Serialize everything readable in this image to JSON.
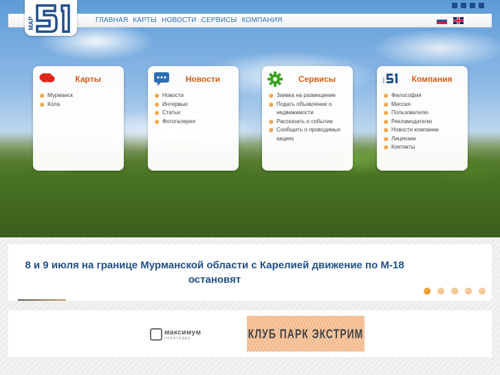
{
  "header": {
    "logo_text": "МАР 51",
    "nav": [
      "ГЛАВНАЯ",
      "КАРТЫ",
      "НОВОСТИ",
      "СЕРВИСЫ",
      "КОМПАНИЯ"
    ],
    "top_icons": [
      "home-icon",
      "sitemap-icon",
      "mail-icon",
      "rss-icon"
    ],
    "languages": [
      "ru",
      "en"
    ]
  },
  "cards": [
    {
      "title": "Карты",
      "icon": "map-region-icon",
      "items": [
        "Мурманск",
        "Кола"
      ]
    },
    {
      "title": "Новости",
      "icon": "chat-bubble-icon",
      "items": [
        "Новости",
        "Интервью",
        "Статьи",
        "Фотогалерея"
      ]
    },
    {
      "title": "Сервисы",
      "icon": "gear-icon",
      "items": [
        "Заявка на размещение",
        "Подать объявление о недвижимости",
        "Рассказать о событии",
        "Сообщить о проводимых акциях"
      ]
    },
    {
      "title": "Компания",
      "icon": "company-logo-icon",
      "items": [
        "Философия",
        "Миссия",
        "Пользователю",
        "Рекламодателю",
        "Новости компании",
        "Лицензии",
        "Контакты"
      ]
    }
  ],
  "news": {
    "headline": "8 и 9 июля на границе Мурманской области с Карелией движение по М-18 остановят",
    "slides": 5,
    "active_slide": 1
  },
  "partners": {
    "maximum": {
      "title": "максимум",
      "subtitle": "скейтпарк"
    },
    "club": {
      "title": "КЛУБ ПАРК ЭКСТРИМ"
    }
  },
  "colors": {
    "accent": "#d95a10",
    "link": "#2b6fb4",
    "headline": "#1f4f86"
  }
}
